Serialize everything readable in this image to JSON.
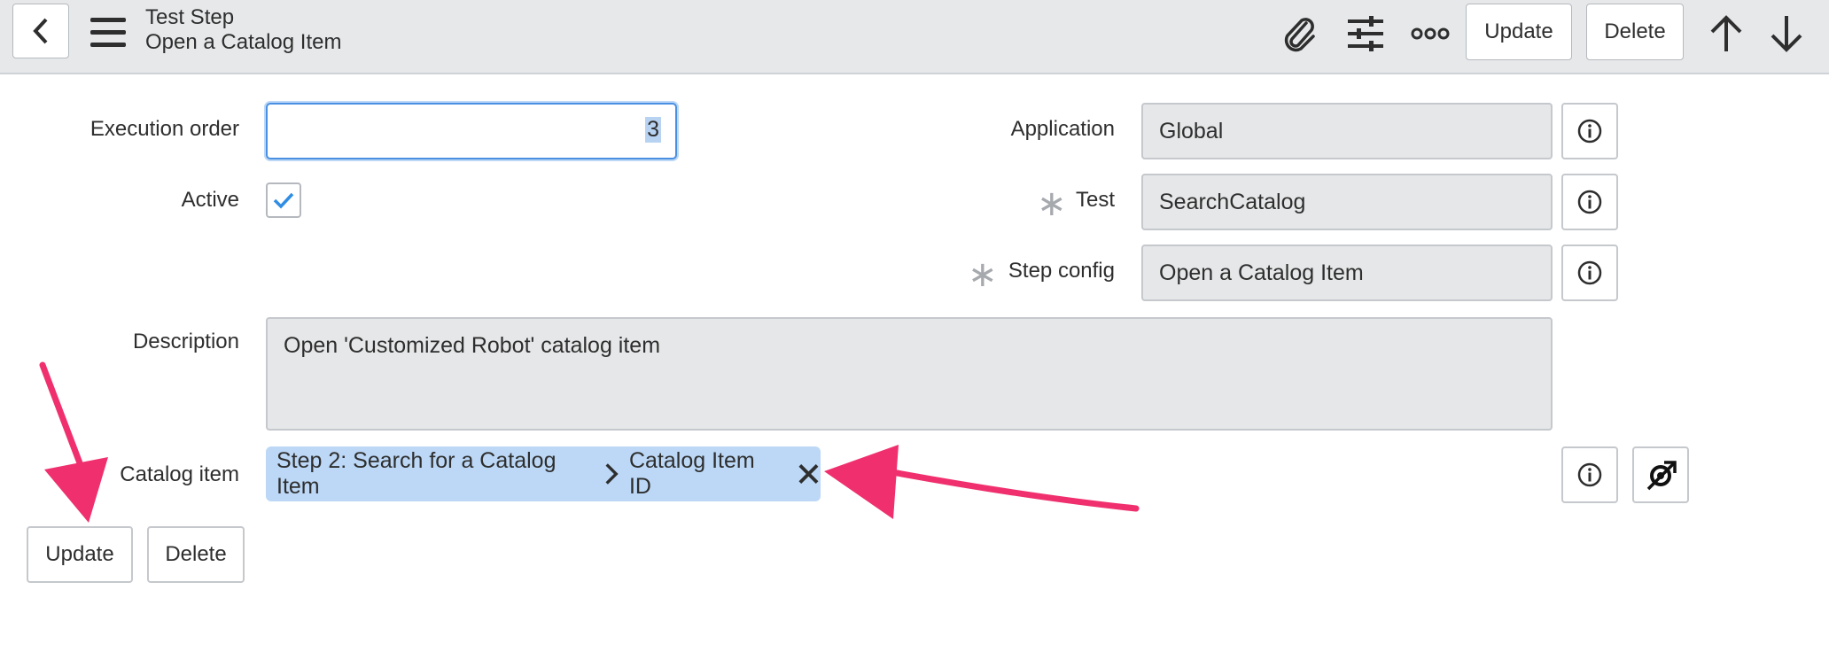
{
  "header": {
    "title": "Test Step",
    "subtitle": "Open a Catalog Item",
    "update_label": "Update",
    "delete_label": "Delete"
  },
  "form": {
    "execution_order": {
      "label": "Execution order",
      "value": "3"
    },
    "active": {
      "label": "Active",
      "checked": true
    },
    "application": {
      "label": "Application",
      "value": "Global"
    },
    "test": {
      "label": "Test",
      "value": "SearchCatalog"
    },
    "step_config": {
      "label": "Step config",
      "value": "Open a Catalog Item"
    },
    "description": {
      "label": "Description",
      "value": "Open 'Customized Robot' catalog item"
    },
    "catalog_item": {
      "label": "Catalog item",
      "pill_step": "Step 2: Search for a Catalog Item",
      "pill_field": "Catalog Item ID"
    }
  },
  "footer": {
    "update_label": "Update",
    "delete_label": "Delete"
  },
  "colors": {
    "header_bg": "#e6e8ea",
    "field_bg": "#e6e7e8",
    "pill_bg": "#bcd8f6",
    "focus_border": "#4a90e2",
    "check_color": "#2f8de4",
    "annotation_arrow": "#f0306e"
  },
  "icons": [
    "back-icon",
    "hamburger-icon",
    "paperclip-icon",
    "sliders-icon",
    "more-icon",
    "arrow-up-icon",
    "arrow-down-icon",
    "info-icon",
    "checkmark-icon",
    "chevron-right-icon",
    "close-icon",
    "dependency-icon"
  ]
}
